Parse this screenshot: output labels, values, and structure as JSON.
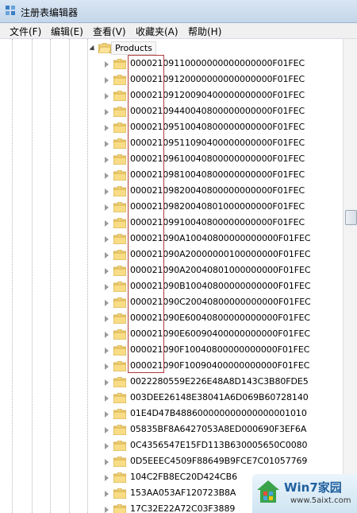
{
  "window": {
    "title": "注册表编辑器"
  },
  "menu": [
    "文件(F)",
    "编辑(E)",
    "查看(V)",
    "收藏夹(A)",
    "帮助(H)"
  ],
  "tree": {
    "parent": "Products",
    "keys": [
      "00002109110000000000000000F01FEC",
      "00002109120000000000000000F01FEC",
      "00002109120090400000000000F01FEC",
      "00002109440040800000000000F01FEC",
      "00002109510040800000000000F01FEC",
      "00002109511090400000000000F01FEC",
      "00002109610040800000000000F01FEC",
      "00002109810040800000000000F01FEC",
      "00002109820040800000000000F01FEC",
      "00002109820040801000000000F01FEC",
      "00002109910040800000000000F01FEC",
      "000021090A10040800000000000F01FEC",
      "000021090A20000000100000000F01FEC",
      "000021090A20040801000000000F01FEC",
      "000021090B10040800000000000F01FEC",
      "000021090C20040800000000000F01FEC",
      "000021090E60040800000000000F01FEC",
      "000021090E60090400000000000F01FEC",
      "000021090F10040800000000000F01FEC",
      "000021090F10090400000000000F01FEC",
      "0022280559E226E48A8D143C3B80FDE5",
      "003DEE26148E38041A6D069B60728140",
      "01E4D47B488600000000000000001010",
      "05835BF8A6427053A8ED000690F3EF6A",
      "0C4356547E15FD113B630005650C0080",
      "0D5EEEC4509F88649B9FCE7C01057769",
      "104C2FB8EC20D424CB6",
      "153AA053AF120723B8A",
      "17C32E22A72C03F3889"
    ]
  },
  "watermark": {
    "brand": "Win7家园",
    "url": "www.5aixt.com"
  }
}
